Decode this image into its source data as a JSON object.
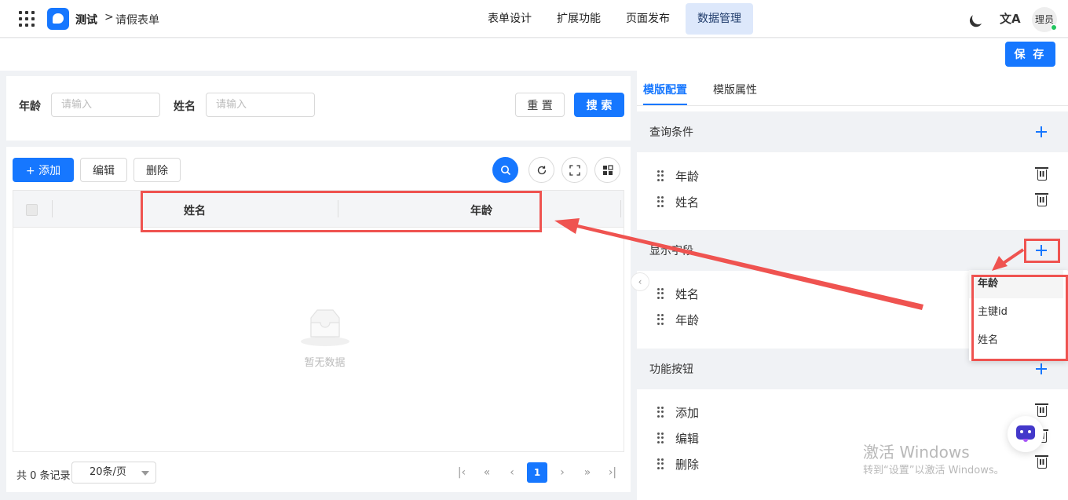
{
  "nav": {
    "app_name": "测试",
    "breadcrumb_sep": ">",
    "page_name": "请假表单",
    "tabs": [
      {
        "label": "表单设计"
      },
      {
        "label": "扩展功能"
      },
      {
        "label": "页面发布"
      },
      {
        "label": "数据管理",
        "active": true
      }
    ],
    "translate_glyph": "文A",
    "avatar_text": "理员"
  },
  "toolbar": {
    "save_label": "保 存"
  },
  "search": {
    "fields": [
      {
        "label": "年龄",
        "placeholder": "请输入"
      },
      {
        "label": "姓名",
        "placeholder": "请输入"
      }
    ],
    "reset_label": "重 置",
    "search_label": "搜 索"
  },
  "table": {
    "add_label": "+ 添加",
    "edit_label": "编辑",
    "delete_label": "删除",
    "columns": [
      "姓名",
      "年龄"
    ],
    "empty_text": "暂无数据",
    "pager": {
      "total_text": "共 0 条记录",
      "page_size": "20条/页",
      "current_page": "1"
    }
  },
  "right_panel": {
    "tabs": [
      "模版配置",
      "模版属性"
    ],
    "sections": [
      {
        "title": "查询条件",
        "items": [
          "年龄",
          "姓名"
        ]
      },
      {
        "title": "显示字段",
        "items": [
          "姓名",
          "年龄"
        ]
      },
      {
        "title": "功能按钮",
        "items": [
          "添加",
          "编辑",
          "删除"
        ]
      }
    ],
    "dropdown": [
      "年龄",
      "主键id",
      "姓名"
    ]
  },
  "watermark": {
    "line1": "激活 Windows",
    "line2": "转到“设置”以激活 Windows。"
  },
  "colors": {
    "primary": "#1677ff",
    "annotation": "#ef5350",
    "nav_active_bg": "#dde8fb"
  }
}
